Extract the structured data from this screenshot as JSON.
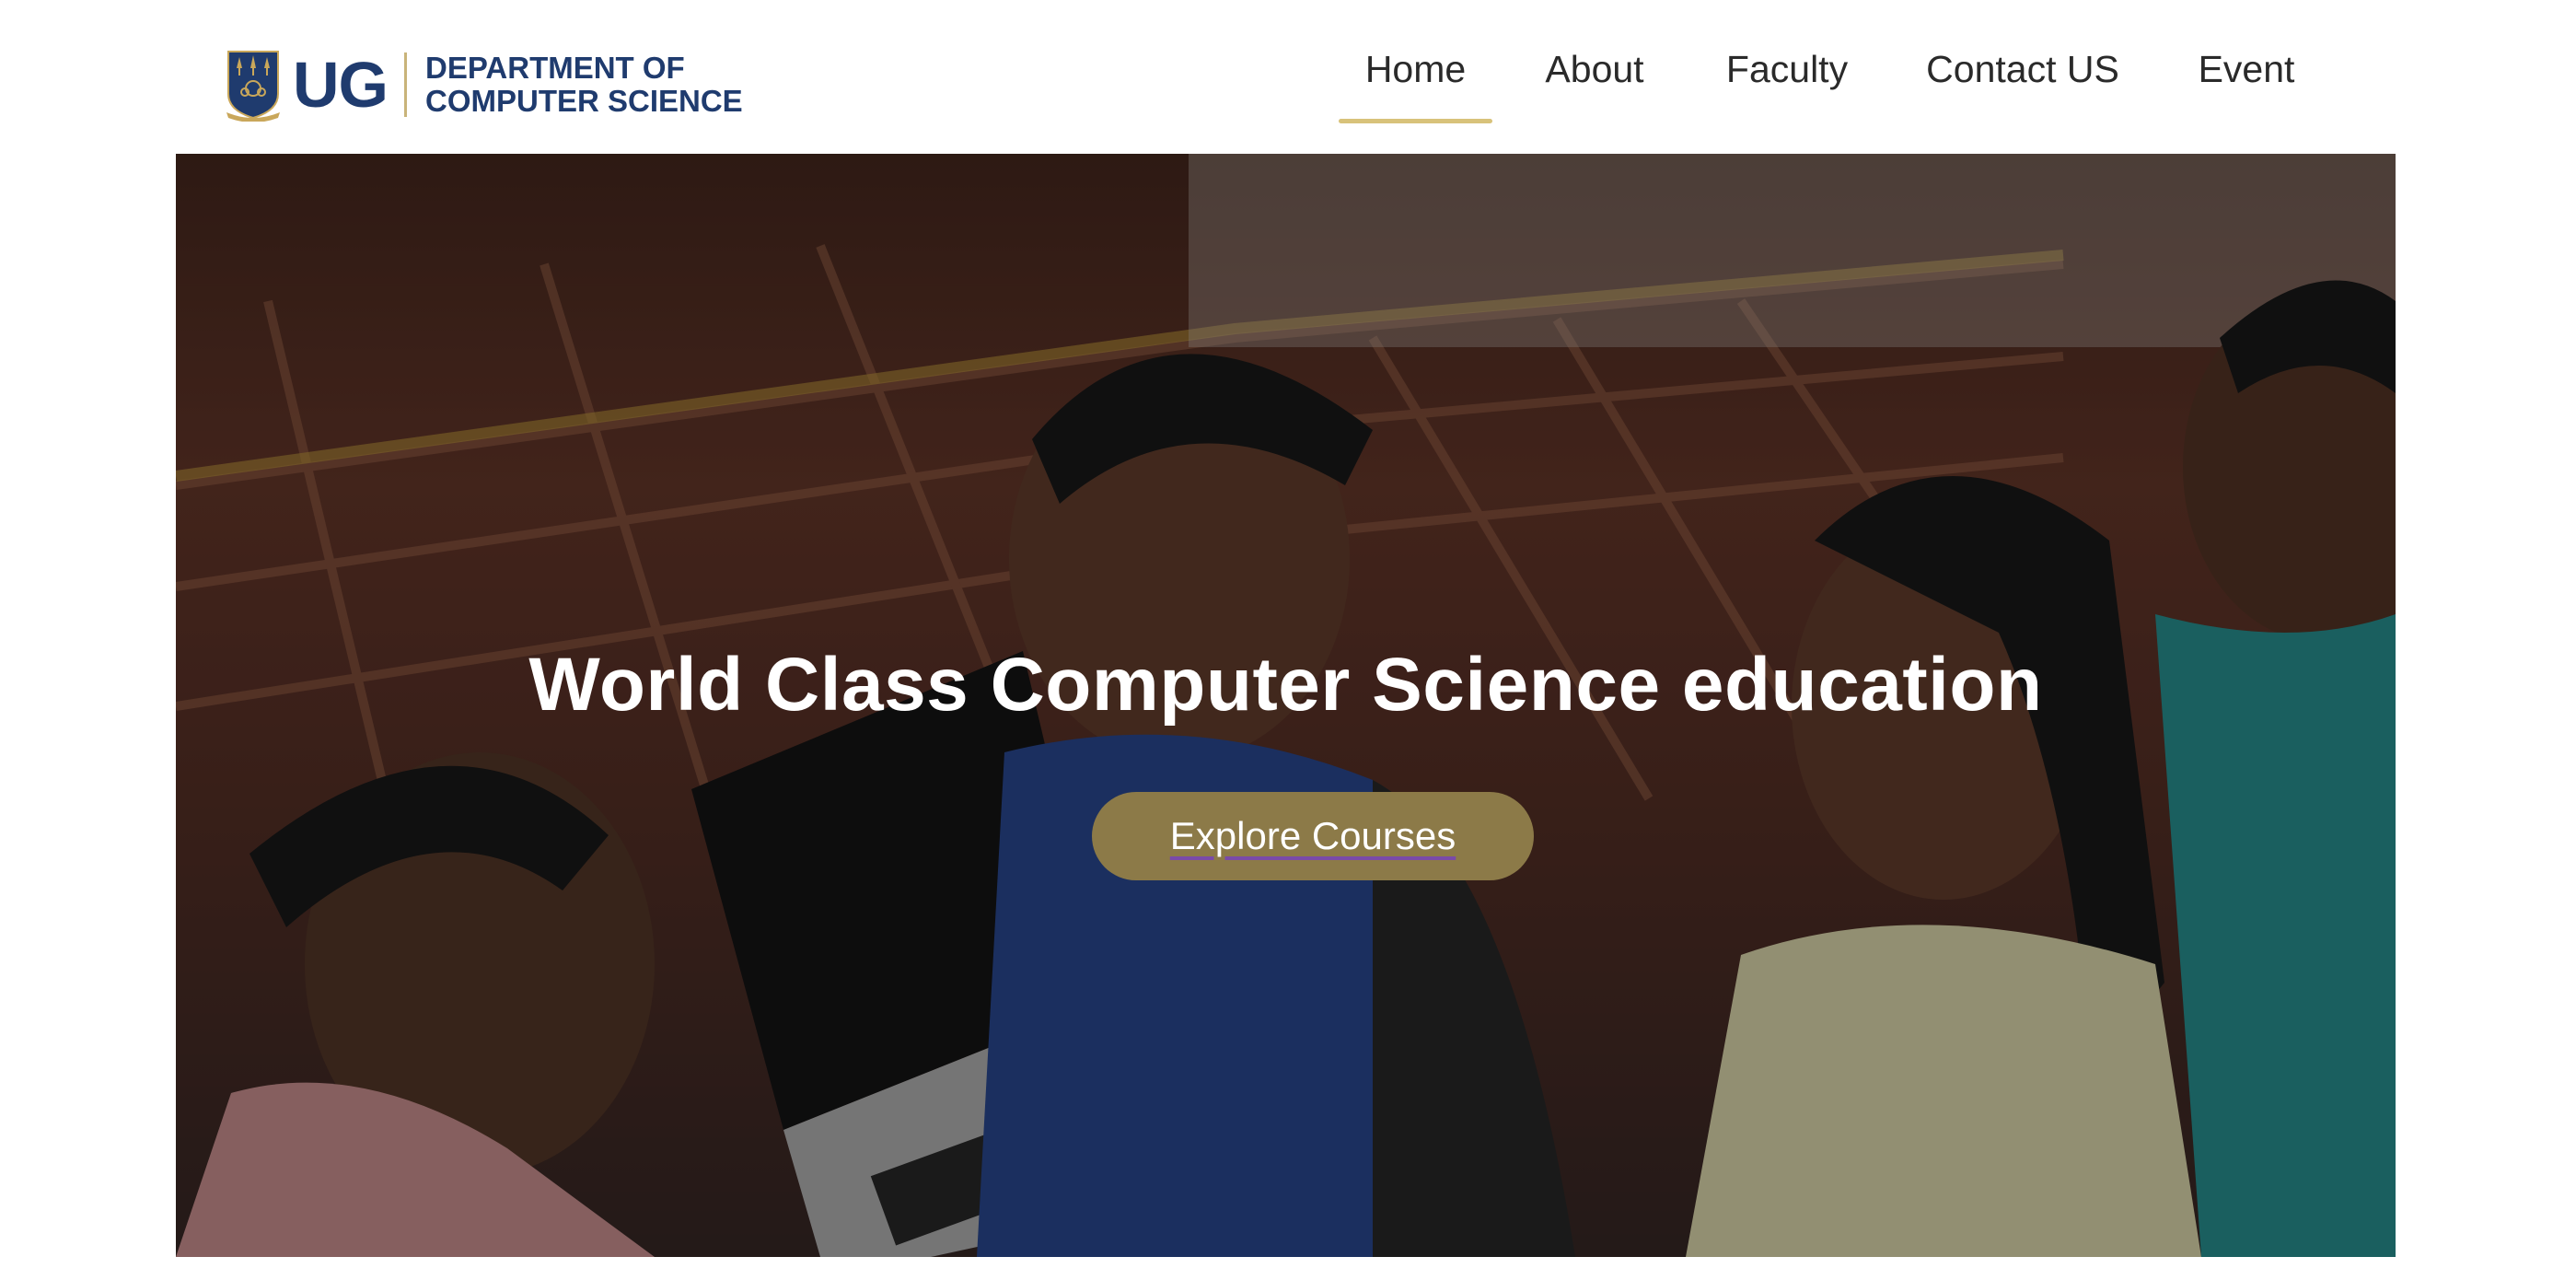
{
  "header": {
    "logo": {
      "short": "UG",
      "line1": "DEPARTMENT OF",
      "line2": "COMPUTER SCIENCE"
    },
    "nav": [
      {
        "label": "Home",
        "active": true
      },
      {
        "label": "About",
        "active": false
      },
      {
        "label": "Faculty",
        "active": false
      },
      {
        "label": "Contact US",
        "active": false
      },
      {
        "label": "Event",
        "active": false
      }
    ]
  },
  "hero": {
    "title": "World Class Computer Science education",
    "cta_label": "Explore Courses"
  },
  "colors": {
    "brand_navy": "#1f3b6e",
    "accent_gold": "#d8c27a",
    "button_gold": "#8c7a48",
    "white": "#ffffff"
  }
}
